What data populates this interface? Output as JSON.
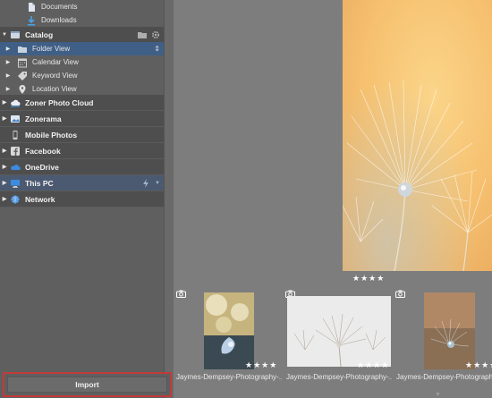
{
  "sidebar": {
    "quick_items": [
      {
        "label": "Documents",
        "icon": "document-icon"
      },
      {
        "label": "Downloads",
        "icon": "download-icon"
      }
    ],
    "catalog": {
      "label": "Catalog",
      "children": [
        {
          "label": "Folder View",
          "icon": "folder-icon",
          "selected": true
        },
        {
          "label": "Calendar View",
          "icon": "calendar-icon"
        },
        {
          "label": "Keyword View",
          "icon": "tag-icon"
        },
        {
          "label": "Location View",
          "icon": "location-pin-icon"
        }
      ]
    },
    "sections": [
      {
        "label": "Zoner Photo Cloud",
        "icon": "cloud-icon"
      },
      {
        "label": "Zonerama",
        "icon": "zonerama-icon"
      },
      {
        "label": "Mobile Photos",
        "icon": "phone-icon"
      },
      {
        "label": "Facebook",
        "icon": "facebook-icon"
      },
      {
        "label": "OneDrive",
        "icon": "onedrive-icon"
      },
      {
        "label": "This PC",
        "icon": "computer-icon"
      },
      {
        "label": "Network",
        "icon": "network-icon"
      }
    ],
    "import_label": "Import"
  },
  "preview": {
    "rating": "★★★★",
    "rating_value": 4
  },
  "filmstrip": [
    {
      "name": "Jaymes-Dempsey-Photography-...",
      "rating": "★★★★"
    },
    {
      "name": "Jaymes-Dempsey-Photography-...",
      "rating": "★★★★"
    },
    {
      "name": "Jaymes-Dempsey-Photography-...",
      "rating": "★★★★"
    }
  ],
  "colors": {
    "sidebar_bg": "#5f5f5f",
    "selected_row": "#3f5f86",
    "main_bg": "#7d7d7d",
    "import_highlight": "#c23a3a"
  }
}
